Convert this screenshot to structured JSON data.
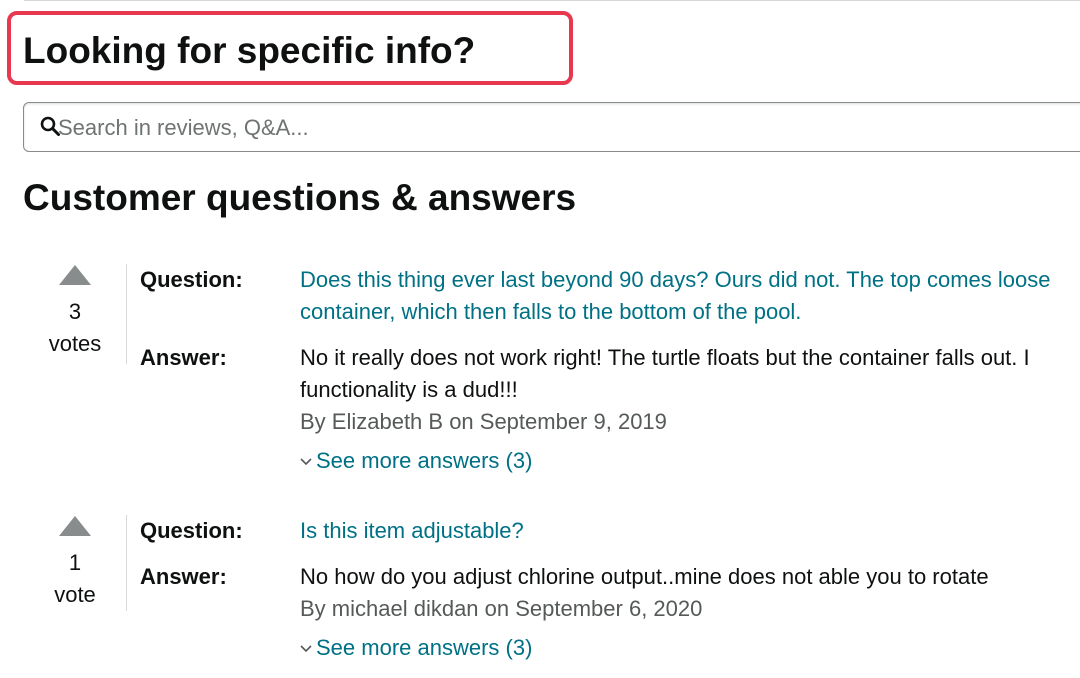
{
  "specific_info": {
    "title": "Looking for specific info?"
  },
  "search": {
    "placeholder": "Search in reviews, Q&A..."
  },
  "qa_section": {
    "title": "Customer questions & answers",
    "items": [
      {
        "votes": "3",
        "votes_label": "votes",
        "question_label": "Question:",
        "question_line1": "Does this thing ever last beyond 90 days? Ours did not. The top comes loose",
        "question_line2": "container, which then falls to the bottom of the pool.",
        "answer_label": "Answer:",
        "answer_line1": "No it really does not work right! The turtle floats but the container falls out. I",
        "answer_line2": "functionality is a dud!!!",
        "byline": "By Elizabeth B on September 9, 2019",
        "more_answers": "See more answers (3)"
      },
      {
        "votes": "1",
        "votes_label": "vote",
        "question_label": "Question:",
        "question_line1": "Is this item adjustable?",
        "answer_label": "Answer:",
        "answer_line1": "No how do you adjust chlorine output..mine does not able you to rotate",
        "byline": "By michael dikdan on September 6, 2020",
        "more_answers": "See more answers (3)"
      }
    ]
  },
  "colors": {
    "link": "#007185",
    "highlight_border": "#e8384f",
    "vote_arrow": "#888c8c",
    "muted_text": "#565959"
  },
  "icons": {
    "search": "magnifier-icon",
    "vote": "triangle-up-icon",
    "expand": "chevron-down-icon"
  }
}
